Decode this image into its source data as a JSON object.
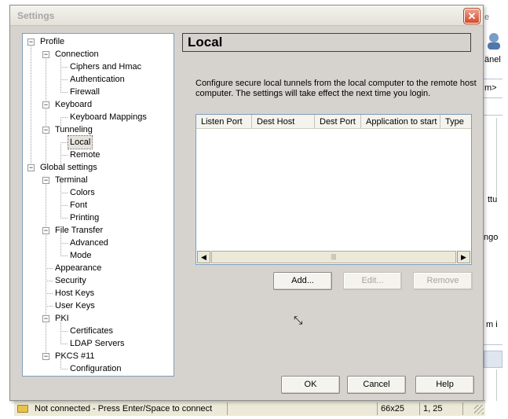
{
  "background": {
    "partial_texts": [
      "e",
      "änel",
      "m>",
      "ttu",
      "ngo",
      "m i"
    ],
    "status": {
      "connection": "Not connected - Press Enter/Space to connect",
      "size": "66x25",
      "position": "1, 25"
    }
  },
  "dialog": {
    "title": "Settings",
    "close_icon": "close-icon",
    "tree": [
      {
        "label": "Profile",
        "level": 0,
        "expander": "−"
      },
      {
        "label": "Connection",
        "level": 1,
        "expander": "−"
      },
      {
        "label": "Ciphers and Hmac",
        "level": 2
      },
      {
        "label": "Authentication",
        "level": 2
      },
      {
        "label": "Firewall",
        "level": 2
      },
      {
        "label": "Keyboard",
        "level": 1,
        "expander": "−"
      },
      {
        "label": "Keyboard Mappings",
        "level": 2
      },
      {
        "label": "Tunneling",
        "level": 1,
        "expander": "−"
      },
      {
        "label": "Local",
        "level": 2,
        "selected": true
      },
      {
        "label": "Remote",
        "level": 2
      },
      {
        "label": "Global settings",
        "level": 0,
        "expander": "−"
      },
      {
        "label": "Terminal",
        "level": 1,
        "expander": "−"
      },
      {
        "label": "Colors",
        "level": 2
      },
      {
        "label": "Font",
        "level": 2
      },
      {
        "label": "Printing",
        "level": 2
      },
      {
        "label": "File Transfer",
        "level": 1,
        "expander": "−"
      },
      {
        "label": "Advanced",
        "level": 2
      },
      {
        "label": "Mode",
        "level": 2
      },
      {
        "label": "Appearance",
        "level": 1
      },
      {
        "label": "Security",
        "level": 1
      },
      {
        "label": "Host Keys",
        "level": 1
      },
      {
        "label": "User Keys",
        "level": 1
      },
      {
        "label": "PKI",
        "level": 1,
        "expander": "−"
      },
      {
        "label": "Certificates",
        "level": 2
      },
      {
        "label": "LDAP Servers",
        "level": 2
      },
      {
        "label": "PKCS #11",
        "level": 1,
        "expander": "−"
      },
      {
        "label": "Configuration",
        "level": 2
      }
    ],
    "panel": {
      "title": "Local",
      "description": "Configure secure local tunnels from the local computer to the remote host computer. The settings will take effect the next time you login.",
      "columns": [
        "Listen Port",
        "Dest Host",
        "Dest Port",
        "Application to start",
        "Type"
      ],
      "scroll_left": "◀",
      "scroll_right": "▶",
      "scroll_grip": "|||",
      "buttons": {
        "add": "Add...",
        "edit": "Edit...",
        "remove": "Remove"
      }
    },
    "footer": {
      "ok": "OK",
      "cancel": "Cancel",
      "help": "Help"
    }
  }
}
